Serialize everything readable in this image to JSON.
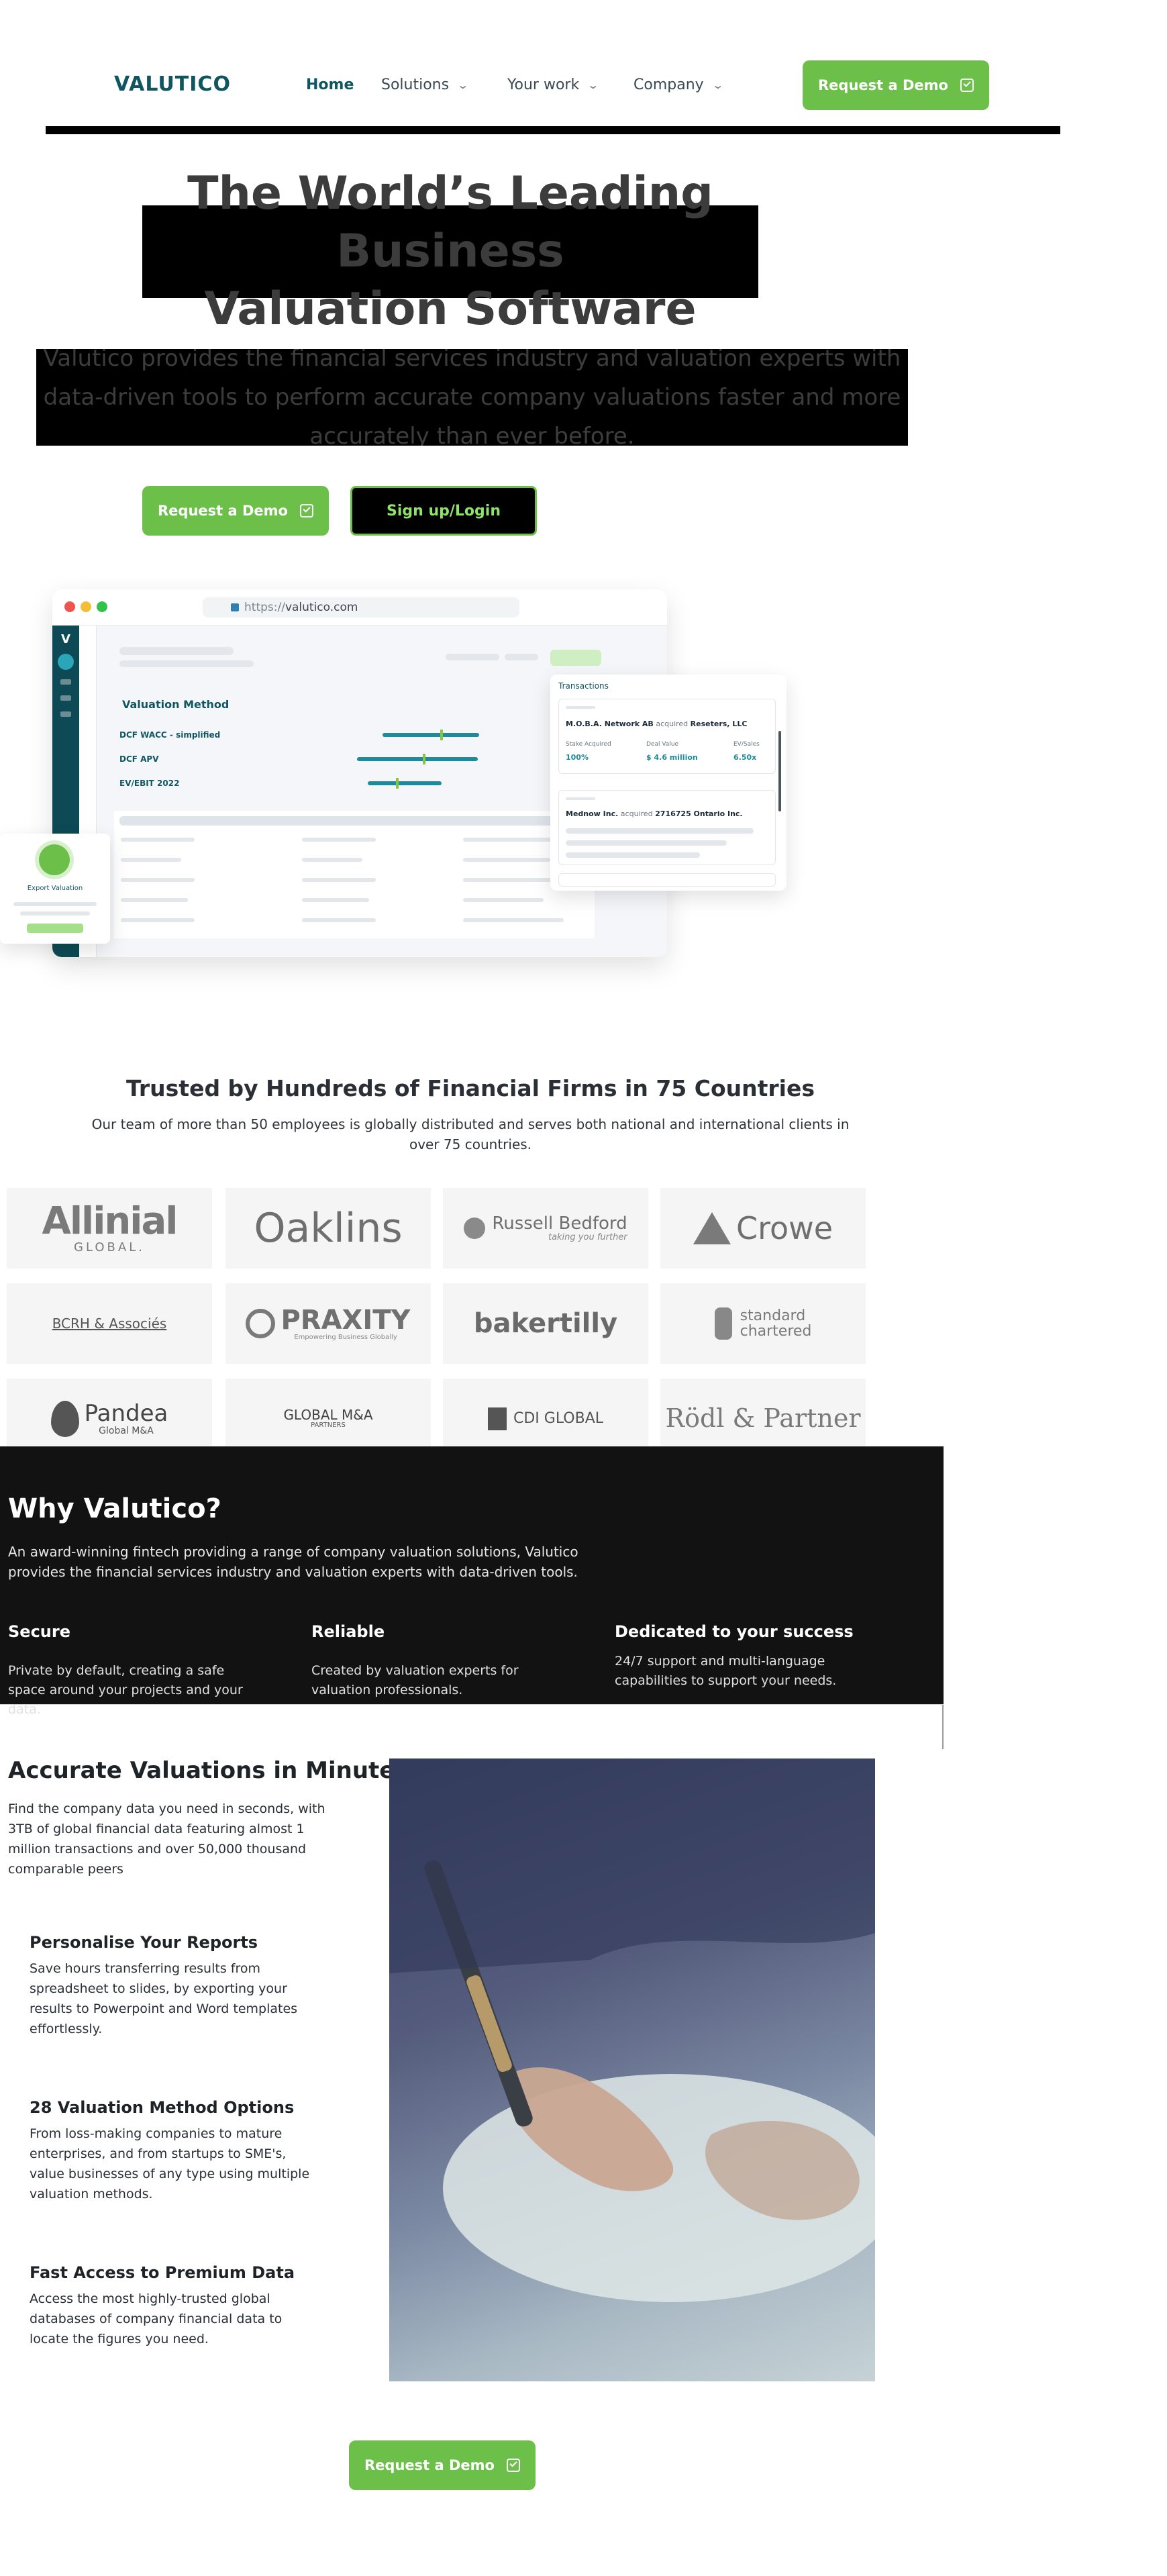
{
  "nav": {
    "logo": "VALUTICO",
    "items": [
      {
        "label": "Home",
        "active": true,
        "dropdown": false
      },
      {
        "label": "Solutions",
        "active": false,
        "dropdown": true
      },
      {
        "label": "Your work",
        "active": false,
        "dropdown": true
      },
      {
        "label": "Company",
        "active": false,
        "dropdown": true
      }
    ],
    "cta_label": "Request a Demo"
  },
  "hero": {
    "title": "The World’s Leading Business\nValuation Software",
    "subtitle": "Valutico provides the financial services industry and valuation experts with data-driven tools to perform accurate company valuations faster and more accurately than ever before.",
    "primary_cta": "Request a Demo",
    "secondary_cta": "Sign up/Login"
  },
  "mockup": {
    "url_prefix": "https://",
    "url_domain": "valutico.com",
    "section_title": "Valuation Method",
    "methods": [
      "DCF WACC - simplified",
      "DCF APV",
      "EV/EBIT 2022"
    ],
    "transactions": {
      "header": "Transactions",
      "deal1": {
        "acquirer": "M.O.B.A. Network AB",
        "verb": "acquired",
        "target": "Reseters, LLC"
      },
      "labels": [
        "Stake Acquired",
        "Deal Value",
        "EV/Sales"
      ],
      "values": [
        "100%",
        "$ 4.6 million",
        "6.50x"
      ],
      "deal2": {
        "acquirer": "Mednow Inc.",
        "verb": "acquired",
        "target": "2716725 Ontario Inc."
      }
    },
    "export_label": "Export Valuation"
  },
  "trust": {
    "title": "Trusted by Hundreds of Financial Firms in 75 Countries",
    "subtitle": "Our team of more than 50 employees is globally distributed and serves both national and international clients in over 75 countries.",
    "logos": [
      {
        "name": "Allinial",
        "sub": "GLOBAL."
      },
      {
        "name": "Oaklins",
        "sub": ""
      },
      {
        "name": "Russell Bedford",
        "sub": "taking you further"
      },
      {
        "name": "Crowe",
        "sub": ""
      },
      {
        "name": "BCRH & Associés",
        "sub": ""
      },
      {
        "name": "PRAXITY",
        "sub": "Empowering Business Globally"
      },
      {
        "name": "bakertilly",
        "sub": ""
      },
      {
        "name": "standard",
        "sub": "chartered"
      },
      {
        "name": "Pandea",
        "sub": "Global M&A"
      },
      {
        "name": "GLOBAL M&A",
        "sub": "PARTNERS"
      },
      {
        "name": "CDI GLOBAL",
        "sub": ""
      },
      {
        "name": "Rödl & Partner",
        "sub": ""
      }
    ]
  },
  "why": {
    "title": "Why Valutico?",
    "subtitle": "An award-winning fintech providing a range of company valuation solutions, Valutico provides the financial services industry and valuation experts with data-driven tools.",
    "columns": [
      {
        "title": "Secure",
        "text": "Private by default, creating a safe space around your projects and your data."
      },
      {
        "title": "Reliable",
        "text": "Created by valuation experts for valuation professionals."
      },
      {
        "title": "Dedicated to your success",
        "text": "24/7 support and multi-language capabilities to support your  needs."
      }
    ]
  },
  "features": {
    "title": "Accurate Valuations in Minutes",
    "subtitle": "Find the company data you need in seconds, with 3TB of global financial data featuring almost 1 million transactions and over 50,000 thousand comparable peers",
    "items": [
      {
        "title": "Personalise Your Reports",
        "text": "Save hours transferring results from spreadsheet to slides, by exporting your results to Powerpoint and Word templates effortlessly."
      },
      {
        "title": "28 Valuation Method Options",
        "text": "From loss-making companies to mature enterprises, and from startups to SME's, value businesses of any type using multiple valuation methods."
      },
      {
        "title": "Fast Access to Premium Data",
        "text": "Access the most highly-trusted global databases of company financial data to locate the figures you need."
      }
    ],
    "cta_label": "Request a Demo"
  },
  "colors": {
    "brand_green": "#6cc04a",
    "brand_teal": "#0f5660",
    "dark_bg": "#121212"
  }
}
